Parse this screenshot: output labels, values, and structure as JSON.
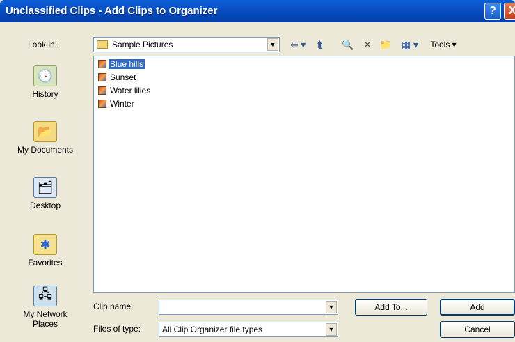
{
  "window": {
    "title": "Unclassified Clips - Add Clips to Organizer",
    "help_glyph": "?",
    "close_glyph": "X"
  },
  "toolbar": {
    "look_in_label": "Look in:",
    "look_in_value": "Sample Pictures",
    "back_glyph": "⇦ ▾",
    "up_glyph": "⮬",
    "search_glyph": "🔍",
    "delete_glyph": "✕",
    "new_folder_glyph": "📁",
    "views_glyph": "▦ ▾",
    "tools_label": "Tools ▾"
  },
  "places": [
    {
      "label": "History",
      "icon": "history-icon"
    },
    {
      "label": "My Documents",
      "icon": "my-documents-icon"
    },
    {
      "label": "Desktop",
      "icon": "desktop-icon"
    },
    {
      "label": "Favorites",
      "icon": "favorites-icon"
    },
    {
      "label": "My Network Places",
      "icon": "network-icon"
    }
  ],
  "files": [
    {
      "name": "Blue hills",
      "selected": true
    },
    {
      "name": "Sunset",
      "selected": false
    },
    {
      "name": "Water lilies",
      "selected": false
    },
    {
      "name": "Winter",
      "selected": false
    }
  ],
  "form": {
    "clip_name_label": "Clip name:",
    "clip_name_value": "",
    "files_of_type_label": "Files of type:",
    "files_of_type_value": "All Clip Organizer file types",
    "add_to_label": "Add To...",
    "add_label": "Add",
    "cancel_label": "Cancel"
  }
}
